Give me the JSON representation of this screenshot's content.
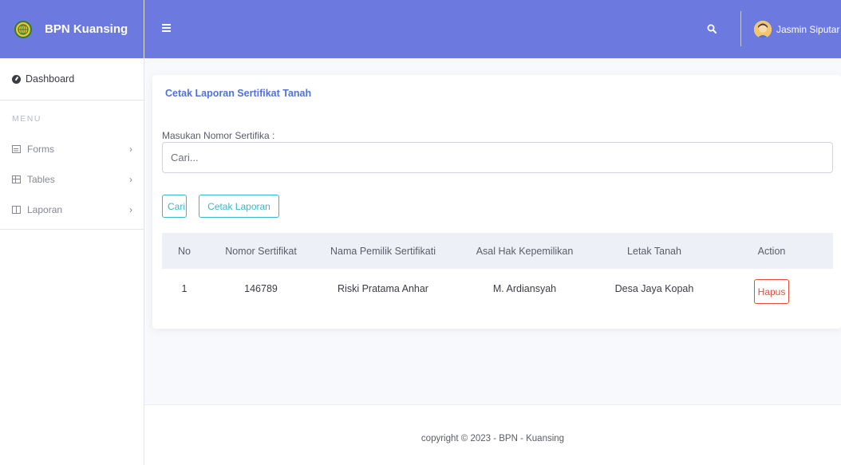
{
  "brand": {
    "name": "BPN Kuansing"
  },
  "sidebar": {
    "dashboard_label": "Dashboard",
    "menu_heading": "MENU",
    "items": [
      {
        "label": "Forms",
        "icon": "form-icon"
      },
      {
        "label": "Tables",
        "icon": "table-icon"
      },
      {
        "label": "Laporan",
        "icon": "report-icon"
      }
    ]
  },
  "topbar": {
    "username": "Jasmin Siputar"
  },
  "main": {
    "card_title": "Cetak Laporan Sertifikat Tanah",
    "field_label": "Masukan Nomor Sertifika :",
    "search_placeholder": "Cari...",
    "btn_cari": "Cari",
    "btn_cetak": "Cetak Laporan",
    "table": {
      "headers": [
        "No",
        "Nomor Sertifikat",
        "Nama Pemilik Sertifikati",
        "Asal Hak Kepemilikan",
        "Letak Tanah",
        "Action"
      ],
      "rows": [
        {
          "no": "1",
          "nomor": "146789",
          "nama": "Riski Pratama Anhar",
          "asal": "M. Ardiansyah",
          "letak": "Desa Jaya Kopah",
          "action": "Hapus"
        }
      ]
    }
  },
  "footer": {
    "text": "copyright © 2023 - BPN - Kuansing"
  },
  "colors": {
    "primary": "#6c7ae0",
    "info": "#36b9cc",
    "danger": "#e74a3b",
    "title": "#4e73df"
  }
}
